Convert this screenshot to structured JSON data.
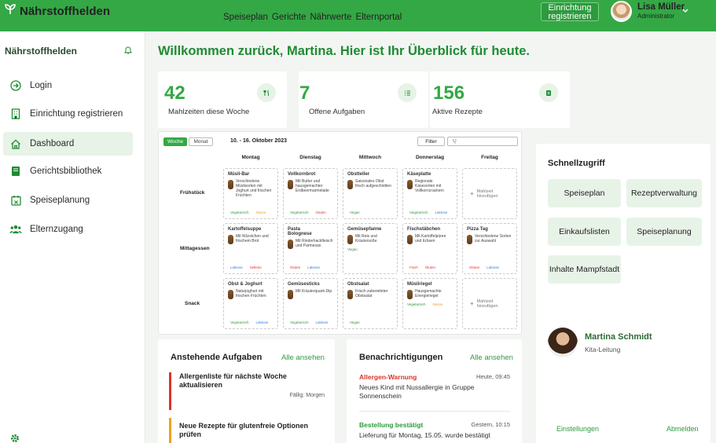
{
  "app": {
    "name": "Nährstoffhelden"
  },
  "topnav": [
    "Speiseplan",
    "Gerichte",
    "Nährwerte",
    "Elternportal"
  ],
  "top_actions": {
    "register_label": "Einrichtung registrieren"
  },
  "user": {
    "name": "Lisa Müller",
    "role": "Administrator"
  },
  "sidebar": {
    "title": "Nährstoffhelden",
    "items": [
      {
        "label": "Login",
        "icon": "login-icon"
      },
      {
        "label": "Einrichtung registrieren",
        "icon": "building-icon"
      },
      {
        "label": "Dashboard",
        "icon": "home-icon",
        "active": true
      },
      {
        "label": "Gerichtsbibliothek",
        "icon": "book-icon"
      },
      {
        "label": "Speiseplanung",
        "icon": "calendar-icon"
      },
      {
        "label": "Elternzugang",
        "icon": "users-icon"
      }
    ]
  },
  "welcome": "Willkommen zurück, Martina. Hier ist Ihr Überblick für heute.",
  "stats": [
    {
      "value": "42",
      "label": "Mahlzeiten diese Woche",
      "icon": "utensils-icon"
    },
    {
      "value": "7",
      "label": "Offene Aufgaben",
      "icon": "list-icon"
    },
    {
      "value": "156",
      "label": "Aktive Rezepte",
      "icon": "recipe-icon"
    }
  ],
  "plan": {
    "tabs": [
      "Woche",
      "Monat"
    ],
    "range": "10. - 16. Oktober 2023",
    "filter_label": "Filter",
    "search_placeholder": "Q",
    "days": [
      "Montag",
      "Dienstag",
      "Mittwoch",
      "Donnerstag",
      "Freitag"
    ],
    "meals": [
      "Frühstück",
      "Mittagessen",
      "Snack"
    ],
    "empty_label": "Mahlzeit hinzufügen",
    "rows": [
      [
        {
          "title": "Müsli-Bar",
          "desc": "Verschiedene Müslisorten mit Joghurt und frischen Früchten",
          "tags": [
            "Vegetarisch",
            "Nüsse"
          ]
        },
        {
          "title": "Vollkornbrot",
          "desc": "Mit Butter und hausgemachter Erdbeermarmelade",
          "tags": [
            "Vegetarisch",
            "Gluten"
          ]
        },
        {
          "title": "Obstteller",
          "desc": "Saisonales Obst frisch aufgeschnitten",
          "tags": [
            "Vegan"
          ]
        },
        {
          "title": "Käseplatte",
          "desc": "Regionale Käsesorten mit Vollkorncrackern",
          "tags": [
            "Vegetarisch",
            "Laktose"
          ]
        },
        null
      ],
      [
        {
          "title": "Kartoffelsuppe",
          "desc": "Mit Würstchen und frischem Brot",
          "tags": [
            "Laktose",
            "Sellerie"
          ]
        },
        {
          "title": "Pasta Bolognese",
          "desc": "Mit Rinderhackfleisch und Parmesan",
          "tags": [
            "Gluten",
            "Laktose"
          ]
        },
        {
          "title": "Gemüsepfanne",
          "desc": "Mit Reis und Kräutersoße",
          "tags": [
            "Vegan"
          ]
        },
        {
          "title": "Fischstäbchen",
          "desc": "Mit Kartoffelpüree und Erbsen",
          "tags": [
            "Fisch",
            "Gluten"
          ]
        },
        {
          "title": "Pizza Tag",
          "desc": "Verschiedene Sorten zur Auswahl",
          "tags": [
            "Gluten",
            "Laktose"
          ]
        }
      ],
      [
        {
          "title": "Obst & Joghurt",
          "desc": "Naturjoghurt mit frischen Früchten",
          "tags": [
            "Vegetarisch",
            "Laktose"
          ]
        },
        {
          "title": "Gemüsesticks",
          "desc": "Mit Kräuterquark-Dip",
          "tags": [
            "Vegetarisch",
            "Laktose"
          ]
        },
        {
          "title": "Obstsalat",
          "desc": "Frisch zubereiteter Obstsalat",
          "tags": [
            "Vegan"
          ]
        },
        {
          "title": "Müsliriegel",
          "desc": "Hausgemachte Energieriegel",
          "tags": [
            "Vegetarisch",
            "Nüsse"
          ]
        },
        null
      ]
    ]
  },
  "tasks": {
    "title": "Anstehende Aufgaben",
    "all_label": "Alle ansehen",
    "items": [
      {
        "title": "Allergenliste für nächste Woche aktualisieren",
        "meta": "Fällig: Morgen",
        "color": "#d9342b"
      },
      {
        "title": "Neue Rezepte für glutenfreie Optionen prüfen",
        "meta": "",
        "color": "#f0a020"
      }
    ]
  },
  "notifications": {
    "title": "Benachrichtigungen",
    "all_label": "Alle ansehen",
    "items": [
      {
        "title": "Allergen-Warnung",
        "time": "Heute, 09:45",
        "body": "Neues Kind mit Nussallergie in Gruppe Sonnenschein",
        "color": "#d9342b"
      },
      {
        "title": "Bestellung bestätigt",
        "time": "Gestern, 10:15",
        "body": "Lieferung für Montag, 15.05. wurde bestätigt",
        "color": "#2e9a3e"
      }
    ]
  },
  "quick_access": {
    "title": "Schnellzugriff",
    "buttons": [
      "Speiseplan",
      "Rezeptverwaltung",
      "Einkaufslisten",
      "Speiseplanung",
      "Inhalte Mampfstadt"
    ]
  },
  "profile": {
    "name": "Martina Schmidt",
    "role": "Kita-Leitung",
    "settings_label": "Einstellungen",
    "logout_label": "Abmelden"
  },
  "colors": {
    "primary": "#34a845",
    "accent_light": "#e6f3e6",
    "danger": "#d9342b",
    "warning": "#f0a020",
    "info": "#3a7bd5"
  }
}
